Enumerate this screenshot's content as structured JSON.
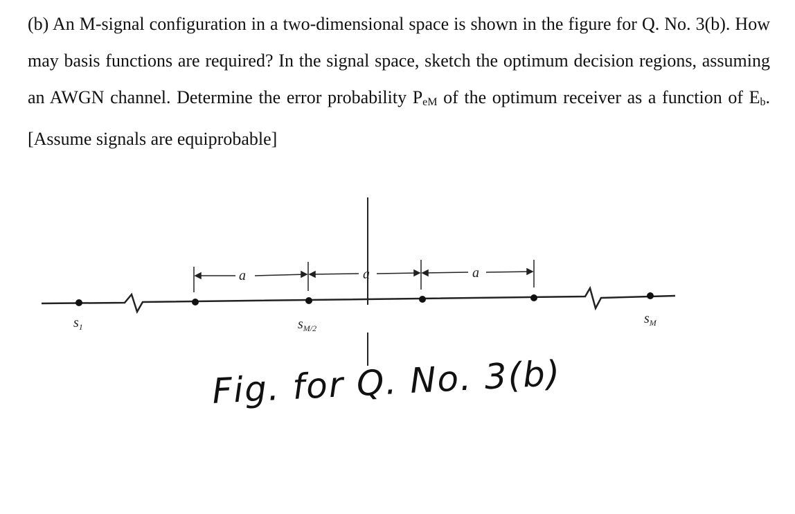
{
  "question": {
    "part": "(b)",
    "text_1": "An M-signal configuration in a two-dimensional space is shown in the figure for Q. No. 3(b). How may basis functions are required? In the signal space, sketch the optimum decision regions, assuming an AWGN channel. Determine the error probability P",
    "pem_sub": "eM",
    "text_2": " of the optimum receiver as a function of E",
    "eb_sub": "b",
    "text_3": ". [Assume signals are equiprobable]"
  },
  "figure": {
    "labels": {
      "s1": "s",
      "s1_sub": "1",
      "smid": "s",
      "smid_sub": "M/2",
      "sM": "s",
      "sM_sub": "M",
      "spacing": "a"
    },
    "caption": "Fig. for Q. No. 3(b)"
  }
}
